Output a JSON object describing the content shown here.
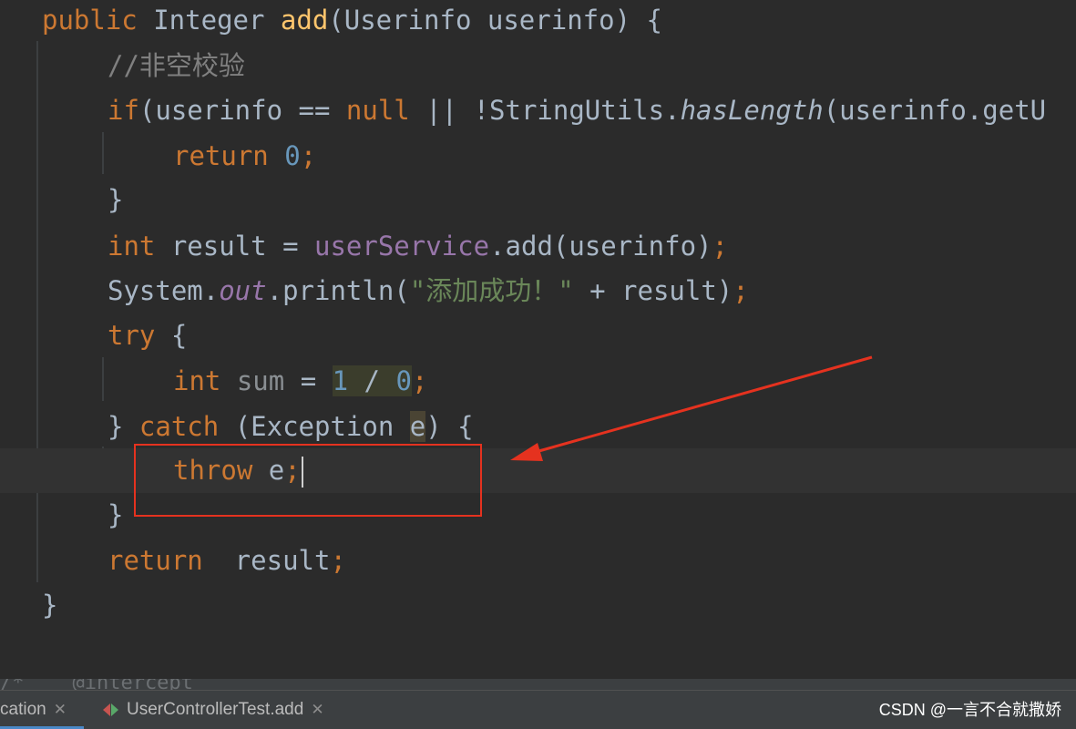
{
  "code": {
    "l1": {
      "a": "public",
      "b": " Integer ",
      "c": "add",
      "d": "(Userinfo userinfo) {"
    },
    "l2": {
      "a": "//非空校验"
    },
    "l3": {
      "a": "if",
      "b": "(userinfo == ",
      "c": "null",
      "d": " || !StringUtils.",
      "e": "hasLength",
      "f": "(userinfo.getU"
    },
    "l4": {
      "a": "return ",
      "b": "0",
      "c": ";"
    },
    "l5": {
      "a": "}"
    },
    "l6": {
      "a": "int",
      "b": " result = ",
      "c": "userService",
      "d": ".add(userinfo)",
      "e": ";"
    },
    "l7": {
      "a": "System.",
      "b": "out",
      "c": ".println(",
      "d": "\"添加成功！\"",
      "e": " + result)",
      "f": ";"
    },
    "l8": {
      "a": "try",
      "b": " {"
    },
    "l9": {
      "a": "int ",
      "b": "sum",
      "c": " = ",
      "d": "1",
      "e": " / ",
      "f": "0",
      "g": ";"
    },
    "l10": {
      "a": "} ",
      "b": "catch",
      "c": " (Exception ",
      "d": "e",
      "e": ") {"
    },
    "l11": {
      "a": "throw",
      "b": " e",
      "c": ";"
    },
    "l12": {
      "a": "}"
    },
    "l13": {
      "a": "return",
      "b": "  result",
      "c": ";"
    },
    "l14": {
      "a": "}"
    },
    "peek": "/*    @intercept"
  },
  "tabs": [
    {
      "label": "cation"
    },
    {
      "label": "UserControllerTest.add"
    }
  ],
  "watermark": "CSDN @一言不合就撒娇",
  "colors": {
    "annotation": "#e5321f",
    "keyword": "#cc7832",
    "number": "#6897bb",
    "string": "#6a8759",
    "method": "#ffc66d",
    "field": "#9876aa"
  }
}
